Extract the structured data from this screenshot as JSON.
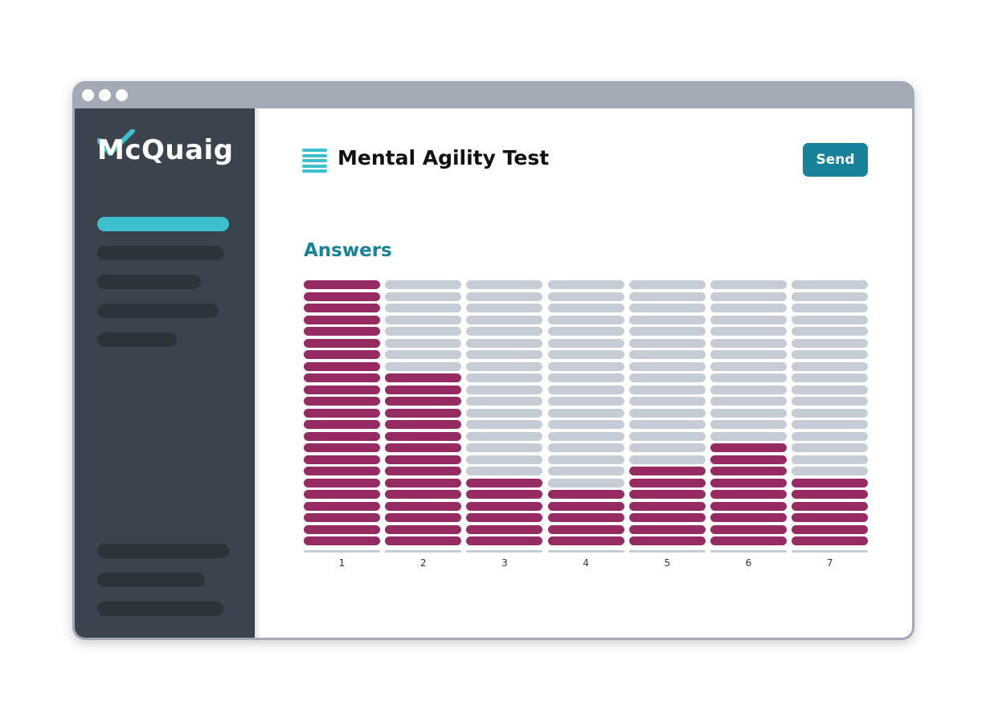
{
  "brand": {
    "logo_text": "McQuaig",
    "accent_color": "#3cc0cd",
    "primary_color": "#18829a",
    "answer_color": "#962b64"
  },
  "header": {
    "icon": "document-lines-icon",
    "title": "Mental Agility Test",
    "send_label": "Send"
  },
  "main": {
    "section_title": "Answers"
  },
  "sidebar": {
    "nav_items": 5,
    "footer_items": 3
  },
  "chart_data": {
    "type": "bar",
    "categories": [
      "1",
      "2",
      "3",
      "4",
      "5",
      "6",
      "7"
    ],
    "values": [
      23,
      15,
      6,
      5,
      7,
      9,
      6
    ],
    "max_segments": 23,
    "title": "Answers",
    "xlabel": "",
    "ylabel": "",
    "ylim": [
      0,
      23
    ],
    "grid": false,
    "legend": "none"
  }
}
